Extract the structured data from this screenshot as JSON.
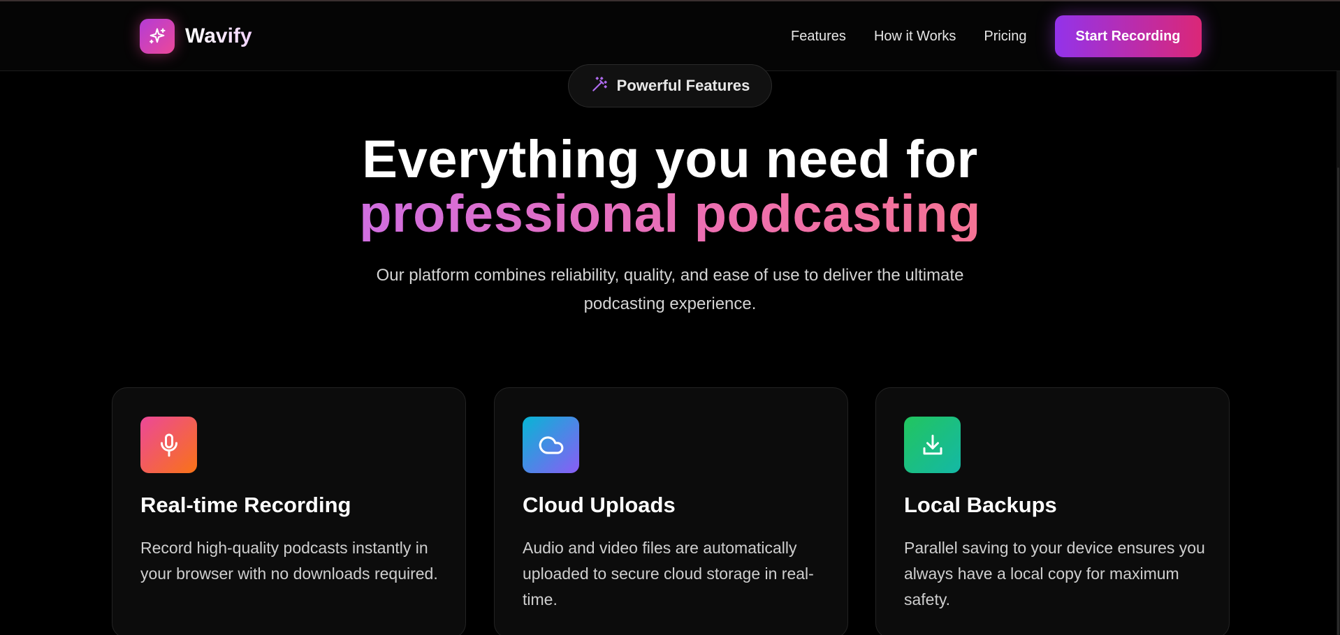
{
  "header": {
    "brand_name": "Wavify",
    "nav": [
      "Features",
      "How it Works",
      "Pricing"
    ],
    "cta_label": "Start Recording"
  },
  "hero": {
    "badge": "Powerful Features",
    "headline_line1": "Everything you need for",
    "headline_line2": "professional podcasting",
    "subtitle": "Our platform combines reliability, quality, and ease of use to deliver the ultimate podcasting experience."
  },
  "features": [
    {
      "icon": "microphone-icon",
      "title": "Real-time Recording",
      "description": "Record high-quality podcasts instantly in your browser with no downloads required.",
      "gradient": [
        "#ec4899",
        "#f97316"
      ]
    },
    {
      "icon": "cloud-icon",
      "title": "Cloud Uploads",
      "description": "Audio and video files are automatically uploaded to secure cloud storage in real-time.",
      "gradient": [
        "#06b6d4",
        "#8b5cf6"
      ]
    },
    {
      "icon": "download-icon",
      "title": "Local Backups",
      "description": "Parallel saving to your device ensures you always have a local copy for maximum safety.",
      "gradient": [
        "#22c55e",
        "#14b8a6"
      ]
    }
  ],
  "colors": {
    "background": "#000000",
    "accent_purple": "#9333ea",
    "accent_pink": "#db2777"
  }
}
